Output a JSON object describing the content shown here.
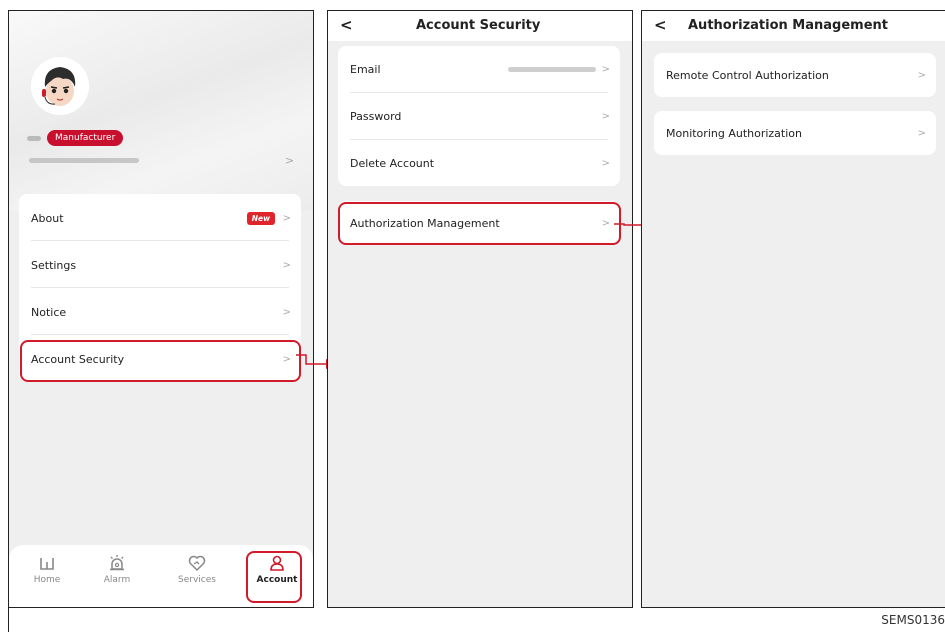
{
  "panel1": {
    "role_badge": "Manufacturer",
    "menu": [
      {
        "label": "About",
        "badge": "New"
      },
      {
        "label": "Settings"
      },
      {
        "label": "Notice"
      },
      {
        "label": "Account Security"
      }
    ],
    "tabs": [
      {
        "label": "Home",
        "icon": "home-icon"
      },
      {
        "label": "Alarm",
        "icon": "alarm-icon"
      },
      {
        "label": "Services",
        "icon": "services-icon"
      },
      {
        "label": "Account",
        "icon": "account-icon",
        "active": true
      }
    ]
  },
  "panel2": {
    "title": "Account Security",
    "items": [
      {
        "label": "Email"
      },
      {
        "label": "Password"
      },
      {
        "label": "Delete Account"
      }
    ],
    "auth_item": "Authorization Management"
  },
  "panel3": {
    "title": "Authorization Management",
    "items": [
      {
        "label": "Remote Control Authorization"
      },
      {
        "label": "Monitoring Authorization"
      }
    ]
  },
  "footer": {
    "code": "SEMS0136"
  },
  "colors": {
    "accent": "#d11a2a",
    "badge": "#c8102e",
    "background": "#efefef"
  }
}
